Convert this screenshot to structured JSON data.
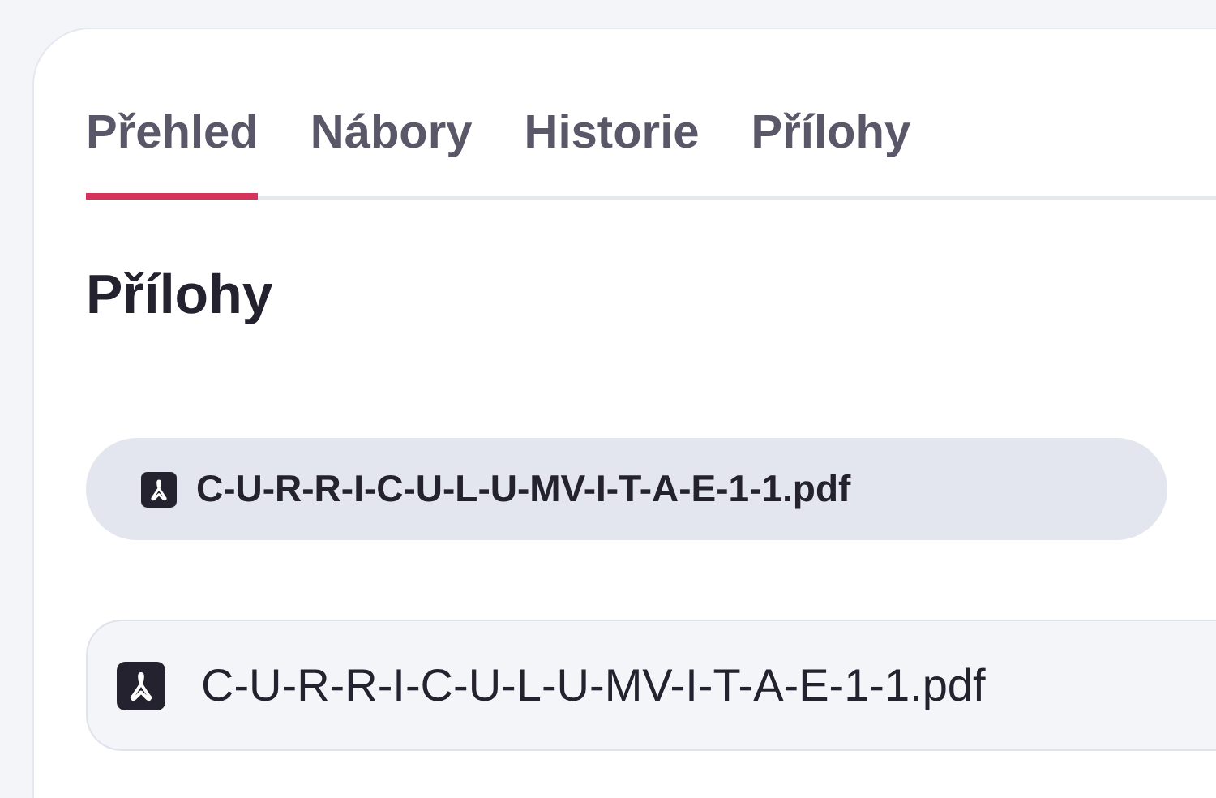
{
  "tabs": [
    {
      "label": "Přehled",
      "selected": true
    },
    {
      "label": "Nábory",
      "selected": false
    },
    {
      "label": "Historie",
      "selected": false
    },
    {
      "label": "Přílohy",
      "selected": false
    }
  ],
  "section": {
    "title": "Přílohy"
  },
  "attachments": [
    {
      "kind": "chip",
      "name": "C-U-R-R-I-C-U-L-U-MV-I-T-A-E-1-1.pdf"
    },
    {
      "kind": "row",
      "name": "C-U-R-R-I-C-U-L-U-MV-I-T-A-E-1-1.pdf"
    }
  ]
}
